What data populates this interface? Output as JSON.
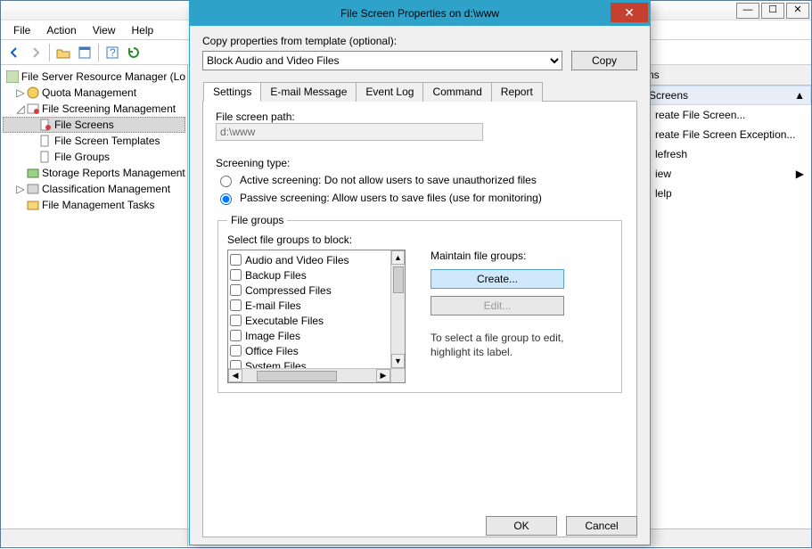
{
  "main_window": {
    "menu": [
      "File",
      "Action",
      "View",
      "Help"
    ],
    "tree_root": "File Server Resource Manager (Lo",
    "tree": {
      "quota": "Quota Management",
      "screening": "File Screening Management",
      "screens": "File Screens",
      "templates": "File Screen Templates",
      "groups": "File Groups",
      "storage": "Storage Reports Management",
      "classification": "Classification Management",
      "tasks": "File Management Tasks"
    },
    "actions_header": "ns",
    "actions_section": "Screens",
    "actions_items": {
      "create_screen": "reate File Screen...",
      "create_exception": "reate File Screen Exception...",
      "refresh": "lefresh",
      "view": "iew",
      "help": "lelp"
    }
  },
  "dialog": {
    "title": "File Screen Properties on d:\\www",
    "copy_label": "Copy properties from template (optional):",
    "template_selected": "Block Audio and Video Files",
    "copy_button": "Copy",
    "tabs": [
      "Settings",
      "E-mail Message",
      "Event Log",
      "Command",
      "Report"
    ],
    "path_label": "File screen path:",
    "path_value": "d:\\www",
    "screening_type_label": "Screening type:",
    "radio_active": "Active screening: Do not allow users to save unauthorized files",
    "radio_passive": "Passive screening: Allow users to save files (use for monitoring)",
    "radio_selected": "passive",
    "filegroups_legend": "File groups",
    "filegroups_label": "Select file groups to block:",
    "filegroups": [
      "Audio and Video Files",
      "Backup Files",
      "Compressed Files",
      "E-mail Files",
      "Executable Files",
      "Image Files",
      "Office Files",
      "System Files"
    ],
    "maintain_label": "Maintain file groups:",
    "create_button": "Create...",
    "edit_button": "Edit...",
    "hint": "To select a file group to edit, highlight its label.",
    "ok": "OK",
    "cancel": "Cancel"
  }
}
